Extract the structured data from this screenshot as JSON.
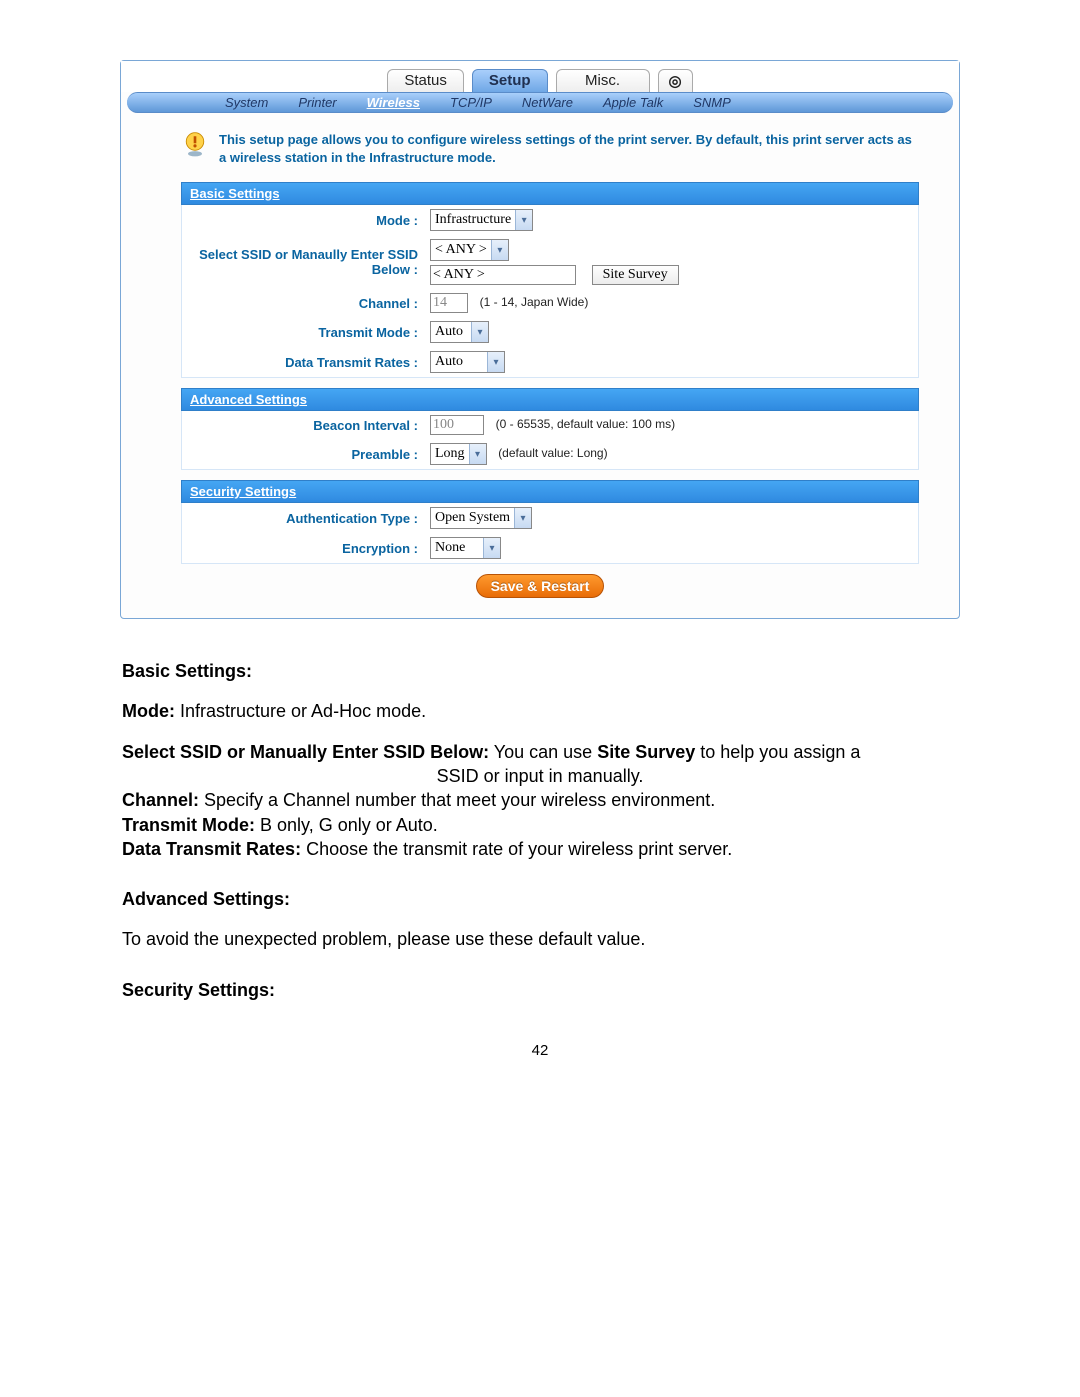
{
  "tabs": {
    "status": "Status",
    "setup": "Setup",
    "misc": "Misc.",
    "power": "◎"
  },
  "subnav": {
    "system": "System",
    "printer": "Printer",
    "wireless": "Wireless",
    "tcpip": "TCP/IP",
    "netware": "NetWare",
    "appletalk": "Apple Talk",
    "snmp": "SNMP"
  },
  "info": "This setup page allows you to configure wireless settings of the print server. By default, this print server acts as a wireless station in the Infrastructure mode.",
  "sections": {
    "basic": {
      "title": "Basic Settings",
      "mode_label": "Mode :",
      "mode_value": "Infrastructure",
      "ssid_label": "Select SSID or Manaully Enter SSID Below :",
      "ssid_dd_value": "< ANY >",
      "ssid_text_value": "< ANY >",
      "site_survey": "Site Survey",
      "channel_label": "Channel :",
      "channel_value": "14",
      "channel_hint": "(1 - 14, Japan Wide)",
      "transmit_mode_label": "Transmit Mode :",
      "transmit_mode_value": "Auto",
      "rates_label": "Data Transmit Rates :",
      "rates_value": "Auto"
    },
    "advanced": {
      "title": "Advanced Settings",
      "beacon_label": "Beacon Interval :",
      "beacon_value": "100",
      "beacon_hint": "(0 - 65535, default value: 100 ms)",
      "preamble_label": "Preamble :",
      "preamble_value": "Long",
      "preamble_hint": "(default value: Long)"
    },
    "security": {
      "title": "Security Settings",
      "auth_label": "Authentication Type :",
      "auth_value": "Open System",
      "enc_label": "Encryption :",
      "enc_value": "None"
    }
  },
  "save_btn": "Save & Restart",
  "doc": {
    "h_basic": "Basic Settings:",
    "mode_b": "Mode:",
    "mode_t": " Infrastructure or Ad-Hoc mode.",
    "ssid_b": "Select SSID or Manually Enter SSID Below:",
    "ssid_t1": " You can use ",
    "ssid_t1b": "Site Survey",
    "ssid_t2": " to help you assign a",
    "ssid_t3": "SSID or input in manually.",
    "chan_b": "Channel:",
    "chan_t": " Specify a Channel number that meet your wireless environment.",
    "tm_b": "Transmit Mode:",
    "tm_t": " B only, G only or Auto.",
    "dtr_b": "Data Transmit Rates:",
    "dtr_t": " Choose the transmit rate of your wireless print server.",
    "h_adv": "Advanced Settings:",
    "adv_t": "To avoid the unexpected problem, please use these default value.",
    "h_sec": "Security Settings:"
  },
  "page_number": "42"
}
